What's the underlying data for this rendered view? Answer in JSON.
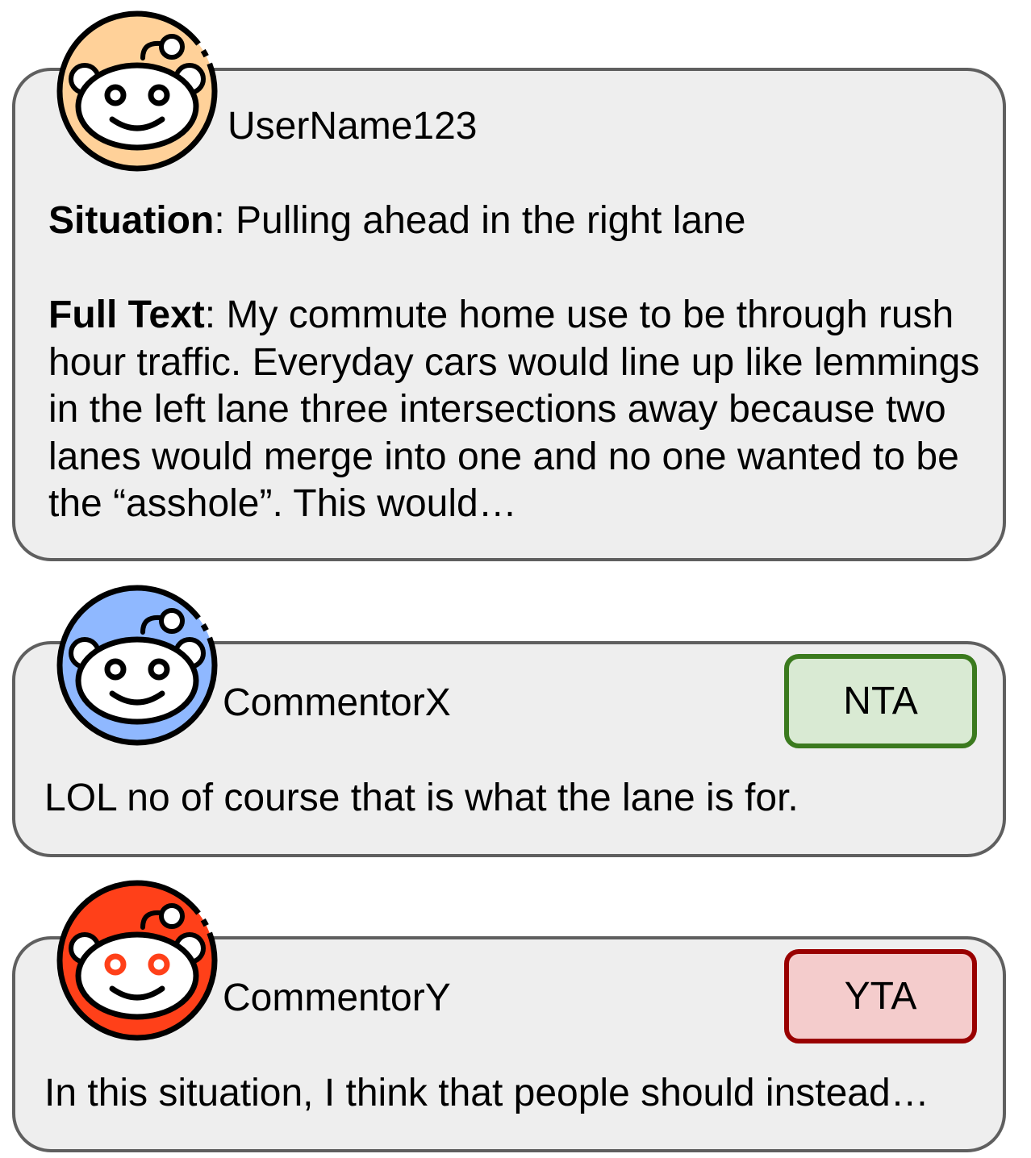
{
  "post": {
    "username": "UserName123",
    "situation_label": "Situation",
    "situation_text": ": Pulling ahead in the right lane",
    "fulltext_label": "Full Text",
    "fulltext_text": ": My commute home use to be through rush hour traffic. Everyday cars would line up like lemmings in the left lane three intersections away because two lanes would merge into one and no one wanted to be the “asshole”. This would…",
    "avatar_color": "#ffd199"
  },
  "comments": [
    {
      "username": "CommentorX",
      "verdict": "NTA",
      "text": "LOL no of course that is what the lane is for.",
      "avatar_color": "#8fb8ff",
      "verdict_fill": "#d9ead3",
      "verdict_border": "#3b7a1e"
    },
    {
      "username": "CommentorY",
      "verdict": "YTA",
      "text": "In this situation, I think that people should instead…",
      "avatar_color": "#ff4019",
      "verdict_fill": "#f4cccc",
      "verdict_border": "#990000"
    }
  ],
  "icons": {
    "avatar": "reddit-snoo-icon"
  }
}
